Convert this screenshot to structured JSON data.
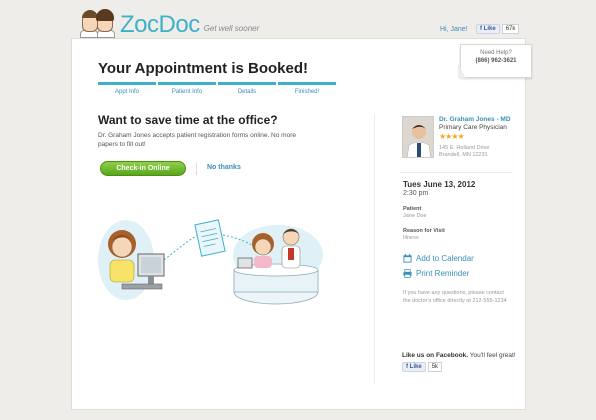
{
  "header": {
    "logo_text": "ZocDoc",
    "tagline": "Get well sooner",
    "greeting": "Hi, Jane!",
    "fb_like_label": "Like",
    "fb_like_count": "67k"
  },
  "help": {
    "line1": "Need Help?",
    "line2": "(866) 962-3621"
  },
  "main": {
    "title": "Your Appointment is Booked!",
    "steps": [
      {
        "label": "Appt Info"
      },
      {
        "label": "Patient Info"
      },
      {
        "label": "Details"
      },
      {
        "label": "Finished!"
      }
    ],
    "promo_heading": "Want to save time at the office?",
    "promo_text": "Dr. Graham Jones accepts patient registration forms online. No more papers to fill out!",
    "checkin_label": "Check-in Online",
    "nothanks_label": "No thanks"
  },
  "sidebar": {
    "doctor_name": "Dr. Graham Jones - MD",
    "specialty": "Primary Care Physician",
    "rating": "★★★★",
    "address_line1": "145 E. Holland Drive",
    "address_line2": "Brandell, MN 12231",
    "date": "Tues June 13, 2012",
    "time": "2:30 pm",
    "patient_label": "Patient",
    "patient_value": "Jane Doe",
    "reason_label": "Reason for Visit",
    "reason_value": "Illness",
    "add_calendar": "Add to Calendar",
    "print_reminder": "Print Reminder",
    "note": "If you have any questions, please contact the doctor's office directly at 212-555-1234",
    "fb_text_bold": "Like us on Facebook.",
    "fb_text_rest": " You'll feel great!",
    "fb_like_label": "Like",
    "fb_like_count": "5k"
  },
  "colors": {
    "accent": "#3eb1c8",
    "link": "#3a8fb7",
    "button_green": "#6bb52a",
    "star": "#f4a81d"
  }
}
